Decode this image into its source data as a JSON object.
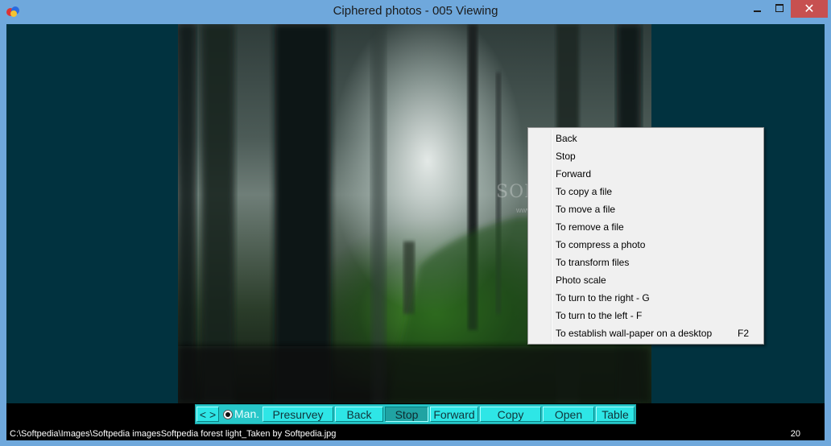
{
  "window": {
    "title": "Ciphered photos - 005 Viewing",
    "close_glyph": "✕"
  },
  "photo": {
    "watermark": "SOFTPEDIA",
    "watermark_url": "www.softpedia.com"
  },
  "toolbar": {
    "nav_label": "< >",
    "mode_label": "Man.",
    "buttons": [
      {
        "label": "Presurvey"
      },
      {
        "label": "Back"
      },
      {
        "label": "Stop"
      },
      {
        "label": "Forward"
      },
      {
        "label": "Copy"
      },
      {
        "label": "Open"
      },
      {
        "label": "Table"
      }
    ],
    "active": "Stop"
  },
  "status": {
    "path": "C:\\Softpedia\\Images\\Softpedia imagesSoftpedia forest light_Taken by Softpedia.jpg",
    "count": "20"
  },
  "context_menu": {
    "items": [
      {
        "label": "Back",
        "shortcut": ""
      },
      {
        "label": "Stop",
        "shortcut": ""
      },
      {
        "label": "Forward",
        "shortcut": ""
      },
      {
        "label": "To copy a file",
        "shortcut": ""
      },
      {
        "label": "To move a file",
        "shortcut": ""
      },
      {
        "label": "To remove a file",
        "shortcut": ""
      },
      {
        "label": "To compress a photo",
        "shortcut": ""
      },
      {
        "label": "To transform files",
        "shortcut": ""
      },
      {
        "label": "Photo scale",
        "shortcut": ""
      },
      {
        "label": "To turn to the right - G",
        "shortcut": ""
      },
      {
        "label": "To turn to the left - F",
        "shortcut": ""
      },
      {
        "label": "To establish wall-paper on a desktop",
        "shortcut": "F2"
      }
    ]
  },
  "colors": {
    "titlebar": "#6fa8dc",
    "client_background": "#01323f",
    "toolbar": "#27c7c9",
    "close_button": "#c75050"
  }
}
